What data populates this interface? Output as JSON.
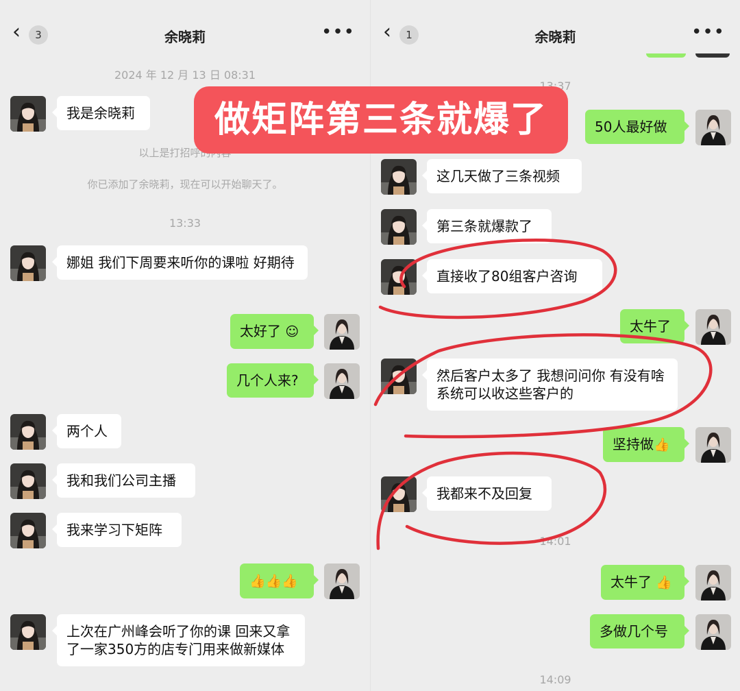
{
  "banner": {
    "text": "做矩阵第三条就爆了"
  },
  "left": {
    "header": {
      "badge": "3",
      "title": "余晓莉"
    },
    "date_time": "2024 年 12 月 13 日 08:31",
    "greeting_hint": "以上是打招呼的内容",
    "added_notice": "你已添加了余晓莉，现在可以开始聊天了。",
    "time_2": "13:33",
    "messages": [
      {
        "text": "我是余晓莉"
      },
      {
        "text": "娜姐 我们下周要来听你的课啦 好期待"
      },
      {
        "text": "太好了",
        "emoji": "☺"
      },
      {
        "text": "几个人来?"
      },
      {
        "text": "两个人"
      },
      {
        "text": "我和我们公司主播"
      },
      {
        "text": "我来学习下矩阵"
      },
      {
        "text": "",
        "emoji": "👍👍👍"
      },
      {
        "text": "上次在广州峰会听了你的课 回来又拿了一家350方的店专门用来做新媒体"
      }
    ]
  },
  "right": {
    "header": {
      "badge": "1",
      "title": "余晓莉"
    },
    "time_1": "13:37",
    "time_2": "14:01",
    "time_3": "14:09",
    "messages": [
      {
        "text": "50人最好做"
      },
      {
        "text": "这几天做了三条视频"
      },
      {
        "text": "第三条就爆款了"
      },
      {
        "text": "直接收了80组客户咨询"
      },
      {
        "text": "太牛了"
      },
      {
        "text": "然后客户太多了 我想问问你 有没有啥系统可以收这些客户的"
      },
      {
        "text": "坚持做",
        "emoji": "👍"
      },
      {
        "text": "我都来不及回复"
      },
      {
        "text": "太牛了",
        "emoji": "👍"
      },
      {
        "text": "多做几个号"
      }
    ]
  },
  "colors": {
    "bg": "#ededed",
    "bubble_out": "#95ec69",
    "bubble_in": "#ffffff",
    "banner": "#f4545a",
    "annotation": "#e0303a"
  },
  "icons": [
    "back-chevron-icon",
    "more-icon",
    "avatar-female-icon",
    "avatar-male-suit-icon"
  ]
}
